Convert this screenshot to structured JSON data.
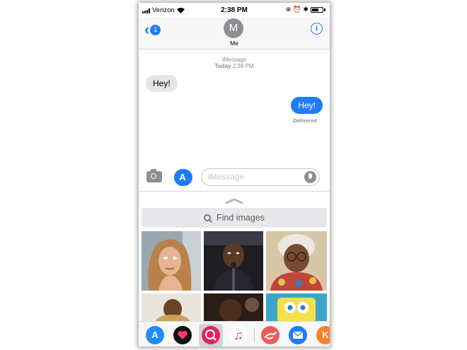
{
  "status_bar": {
    "carrier": "Verizon",
    "time": "2:38 PM"
  },
  "header": {
    "back_badge_count": "1",
    "avatar_initial": "M",
    "contact_name": "Me",
    "info_label": "i"
  },
  "conversation": {
    "service_label": "iMessage",
    "date_label": "Today",
    "date_time": "2:38 PM",
    "messages": [
      {
        "direction": "incoming",
        "text": "Hey!"
      },
      {
        "direction": "outgoing",
        "text": "Hey!"
      }
    ],
    "delivery_status": "Delivered"
  },
  "composer": {
    "placeholder": "iMessage"
  },
  "image_search": {
    "placeholder": "Find images",
    "results": [
      {
        "icon": "woman-eye-roll-gif"
      },
      {
        "icon": "man-microphone-gif"
      },
      {
        "icon": "madea-gif"
      },
      {
        "icon": "man-ceiling-gif"
      },
      {
        "icon": "man-dark-gif"
      },
      {
        "icon": "spongebob-gif"
      }
    ]
  },
  "app_strip": {
    "apps": [
      {
        "icon": "app-store-icon"
      },
      {
        "icon": "digital-touch-icon"
      },
      {
        "icon": "image-search-icon",
        "selected": true
      },
      {
        "icon": "music-icon"
      },
      {
        "icon": "rabbit-app-icon"
      },
      {
        "icon": "mail-icon"
      },
      {
        "icon": "k-app-icon",
        "label": "K"
      }
    ]
  },
  "colors": {
    "accent": "#1f7cf7",
    "incoming_bubble": "#e5e5ea",
    "secondary_text": "#8e8e93"
  }
}
